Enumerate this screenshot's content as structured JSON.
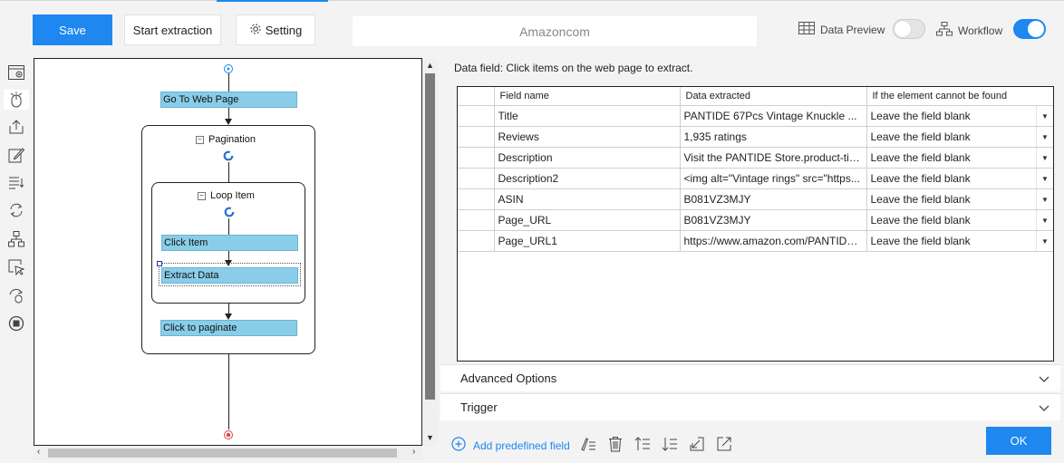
{
  "toolbar": {
    "save_label": "Save",
    "start_extraction_label": "Start extraction",
    "setting_label": "Setting",
    "url": "Amazoncom",
    "data_preview_label": "Data Preview",
    "data_preview_on": false,
    "workflow_label": "Workflow",
    "workflow_on": true,
    "accent_color": "#1e87f0"
  },
  "sidebar_icons": [
    "browser-add-icon",
    "mouse-click-icon",
    "export-icon",
    "edit-icon",
    "list-settings-icon",
    "loop-icon",
    "branch-icon",
    "cursor-select-icon",
    "refresh-mouse-icon",
    "stop-icon"
  ],
  "workflow": {
    "go_to_web_page": "Go To Web Page",
    "pagination": "Pagination",
    "loop_item": "Loop Item",
    "click_item": "Click Item",
    "extract_data": "Extract Data",
    "click_to_paginate": "Click to paginate"
  },
  "main": {
    "hint": "Data field: Click items on the web page to extract.",
    "columns": [
      "Field name",
      "Data extracted",
      "If the element cannot be found"
    ],
    "rows": [
      {
        "field": "Title",
        "data": "PANTIDE 67Pcs Vintage Knuckle ...",
        "fallback": "Leave the field blank"
      },
      {
        "field": "Reviews",
        "data": "1,935 ratings",
        "fallback": "Leave the field blank"
      },
      {
        "field": "Description",
        "data": "Visit the PANTIDE Store.product-titl...",
        "fallback": "Leave the field blank"
      },
      {
        "field": "Description2",
        "data": "<img alt=\"Vintage rings\" src=\"https...",
        "fallback": "Leave the field blank"
      },
      {
        "field": "ASIN",
        "data": "B081VZ3MJY",
        "fallback": "Leave the field blank"
      },
      {
        "field": "Page_URL",
        "data": "B081VZ3MJY",
        "fallback": "Leave the field blank"
      },
      {
        "field": "Page_URL1",
        "data": "https://www.amazon.com/PANTIDE...",
        "fallback": "Leave the field blank"
      }
    ],
    "advanced_options": "Advanced Options",
    "trigger": "Trigger",
    "add_predefined": "Add predefined field",
    "ok_label": "OK"
  }
}
